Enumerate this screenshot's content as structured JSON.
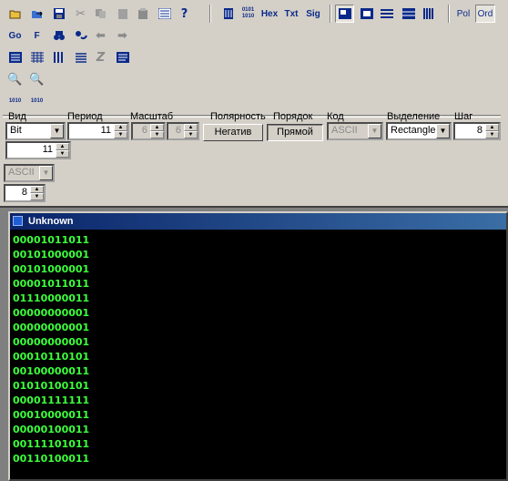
{
  "toolbar1": {
    "buttons": [
      {
        "name": "open-icon",
        "glyph": "📂"
      },
      {
        "name": "open-save-icon",
        "glyph": "⇥"
      },
      {
        "name": "save-icon",
        "glyph": "💾"
      },
      {
        "name": "cut-icon",
        "glyph": "✂"
      },
      {
        "name": "copy-icon",
        "glyph": "⧉"
      },
      {
        "name": "paste-icon",
        "glyph": "📋"
      },
      {
        "name": "clipboard-icon",
        "glyph": "📋"
      },
      {
        "name": "properties-icon",
        "glyph": "▦"
      },
      {
        "name": "help-icon",
        "glyph": "?"
      }
    ],
    "view_bits_label": "0101\n1010",
    "hex_label": "Hex",
    "txt_label": "Txt",
    "sig_label": "Sig",
    "pol_label": "Pol",
    "ord_label": "Ord"
  },
  "toolbar2": {
    "go_label": "Go",
    "f_label": "F"
  },
  "toolbar5": {
    "left_label": "1010",
    "right_label": "1010"
  },
  "controls": {
    "vid_label": "Вид",
    "vid_value": "Bit",
    "period_label": "Период",
    "period_value": "11",
    "scale_label": "Масштаб",
    "scale_value1": "6",
    "scale_value2": "6",
    "polarity_label": "Полярность",
    "polarity_button": "Негатив",
    "order_label": "Порядок",
    "order_button": "Прямой",
    "code_label": "Код",
    "code_value": "ASCII",
    "selection_label": "Выделение",
    "selection_value": "Rectangle",
    "step_label": "Шаг",
    "step_value": "8",
    "row2_value": "11",
    "row3_value": "ASCII",
    "row4_value": "8"
  },
  "window": {
    "title": "Unknown",
    "lines": [
      "00001011011",
      "00101000001",
      "00101000001",
      "00001011011",
      "01110000011",
      "00000000001",
      "00000000001",
      "00000000001",
      "00010110101",
      "00100000011",
      "01010100101",
      "00001111111",
      "00010000011",
      "00000100011",
      "00111101011",
      "00110100011"
    ]
  }
}
